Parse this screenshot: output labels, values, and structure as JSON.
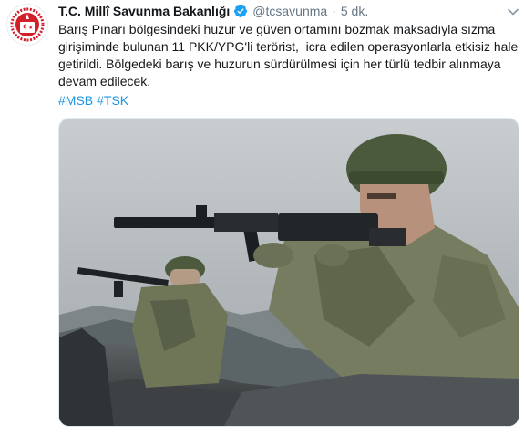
{
  "author": {
    "display_name": "T.C. Millî Savunma Bakanlığı",
    "handle": "@tcsavunma",
    "separator": "·",
    "timestamp": "5 dk.",
    "verified": true
  },
  "tweet": {
    "lines": [
      "Barış Pınarı bölgesindeki huzur ve güven ortamını bozmak maksadıyla sızma",
      "girişiminde bulunan 11 PKK/YPG'li terörist,  icra edilen operasyonlarla etkisiz hale",
      "getirildi. Bölgedeki barış ve huzurun sürdürülmesi için her türlü tedbir alınmaya",
      "devam edilecek."
    ],
    "hashtags": [
      "#MSB",
      "#TSK"
    ]
  },
  "colors": {
    "link": "#1b95e0",
    "verified": "#1da1f2",
    "secondary_text": "#657786",
    "logo_red": "#d21f2a"
  },
  "icons": {
    "verified": "verified-badge-icon",
    "menu": "chevron-down-icon"
  }
}
